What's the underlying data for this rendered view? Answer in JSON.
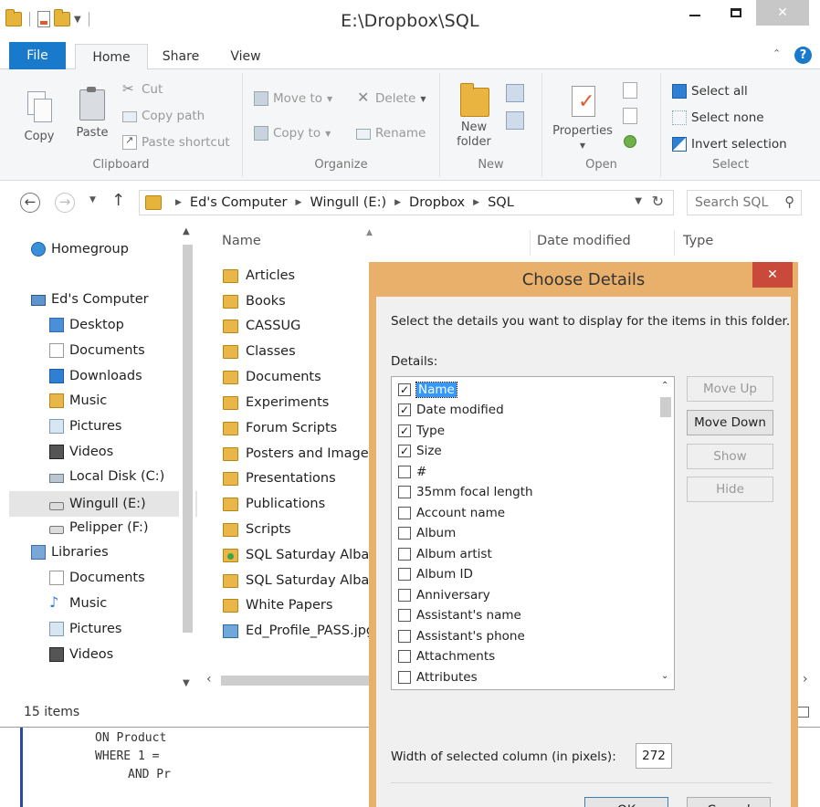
{
  "window": {
    "title": "E:\\Dropbox\\SQL"
  },
  "ribbon": {
    "tabs": [
      "File",
      "Home",
      "Share",
      "View"
    ],
    "clipboard": {
      "label": "Clipboard",
      "copy": "Copy",
      "paste": "Paste",
      "cut": "Cut",
      "copy_path": "Copy path",
      "paste_shortcut": "Paste shortcut"
    },
    "organize": {
      "label": "Organize",
      "move_to": "Move to",
      "copy_to": "Copy to",
      "delete": "Delete",
      "rename": "Rename"
    },
    "new": {
      "label": "New",
      "new_folder_line1": "New",
      "new_folder_line2": "folder"
    },
    "open": {
      "label": "Open",
      "properties": "Properties"
    },
    "select": {
      "label": "Select",
      "select_all": "Select all",
      "select_none": "Select none",
      "invert_selection": "Invert selection"
    }
  },
  "address": {
    "crumbs": [
      "Ed's Computer",
      "Wingull (E:)",
      "Dropbox",
      "SQL"
    ],
    "search_placeholder": "Search SQL"
  },
  "nav_pane": {
    "items": [
      {
        "label": "Homegroup",
        "icon": "homegroup-icon"
      },
      {
        "label": "Ed's Computer",
        "icon": "computer-icon"
      },
      {
        "label": "Desktop",
        "icon": "desktop-icon"
      },
      {
        "label": "Documents",
        "icon": "documents-icon"
      },
      {
        "label": "Downloads",
        "icon": "downloads-icon"
      },
      {
        "label": "Music",
        "icon": "music-icon"
      },
      {
        "label": "Pictures",
        "icon": "pictures-icon"
      },
      {
        "label": "Videos",
        "icon": "videos-icon"
      },
      {
        "label": "Local Disk (C:)",
        "icon": "local-disk-icon"
      },
      {
        "label": "Wingull (E:)",
        "icon": "drive-icon"
      },
      {
        "label": "Pelipper (F:)",
        "icon": "drive-icon"
      },
      {
        "label": "Libraries",
        "icon": "libraries-icon"
      },
      {
        "label": "Documents",
        "icon": "documents-icon"
      },
      {
        "label": "Music",
        "icon": "music-note-icon"
      },
      {
        "label": "Pictures",
        "icon": "pictures-icon"
      },
      {
        "label": "Videos",
        "icon": "videos-icon"
      }
    ],
    "selected": "Wingull (E:)"
  },
  "file_list": {
    "columns": [
      "Name",
      "Date modified",
      "Type"
    ],
    "items": [
      {
        "name": "Articles",
        "kind": "folder"
      },
      {
        "name": "Books",
        "kind": "folder"
      },
      {
        "name": "CASSUG",
        "kind": "folder"
      },
      {
        "name": "Classes",
        "kind": "folder"
      },
      {
        "name": "Documents",
        "kind": "folder"
      },
      {
        "name": "Experiments",
        "kind": "folder"
      },
      {
        "name": "Forum Scripts",
        "kind": "folder"
      },
      {
        "name": "Posters and Images",
        "kind": "folder"
      },
      {
        "name": "Presentations",
        "kind": "folder"
      },
      {
        "name": "Publications",
        "kind": "folder"
      },
      {
        "name": "Scripts",
        "kind": "folder"
      },
      {
        "name": "SQL Saturday Alban",
        "kind": "folder-shared"
      },
      {
        "name": "SQL Saturday Alban",
        "kind": "folder"
      },
      {
        "name": "White Papers",
        "kind": "folder"
      },
      {
        "name": "Ed_Profile_PASS.jpg",
        "kind": "image"
      }
    ]
  },
  "status": {
    "item_count": "15 items"
  },
  "code_window": {
    "lines": [
      "ON Product",
      "WHERE 1 =",
      "AND Pr"
    ]
  },
  "dialog": {
    "title": "Choose Details",
    "description": "Select the details you want to display for the items in this folder.",
    "details_label": "Details:",
    "details": [
      {
        "label": "Name",
        "checked": true,
        "selected": true
      },
      {
        "label": "Date modified",
        "checked": true
      },
      {
        "label": "Type",
        "checked": true
      },
      {
        "label": "Size",
        "checked": true
      },
      {
        "label": "#",
        "checked": false
      },
      {
        "label": "35mm focal length",
        "checked": false
      },
      {
        "label": "Account name",
        "checked": false
      },
      {
        "label": "Album",
        "checked": false
      },
      {
        "label": "Album artist",
        "checked": false
      },
      {
        "label": "Album ID",
        "checked": false
      },
      {
        "label": "Anniversary",
        "checked": false
      },
      {
        "label": "Assistant's name",
        "checked": false
      },
      {
        "label": "Assistant's phone",
        "checked": false
      },
      {
        "label": "Attachments",
        "checked": false
      },
      {
        "label": "Attributes",
        "checked": false
      }
    ],
    "buttons": {
      "move_up": "Move Up",
      "move_down": "Move Down",
      "show": "Show",
      "hide": "Hide",
      "ok": "OK",
      "cancel": "Cancel"
    },
    "width_label": "Width of selected column (in pixels):",
    "width_value": "272"
  },
  "colors": {
    "file_tab": "#1979ca",
    "dialog_frame": "#e9b06b",
    "dialog_close": "#c94a3b",
    "selection": "#3399ff",
    "folder": "#e8b649"
  }
}
